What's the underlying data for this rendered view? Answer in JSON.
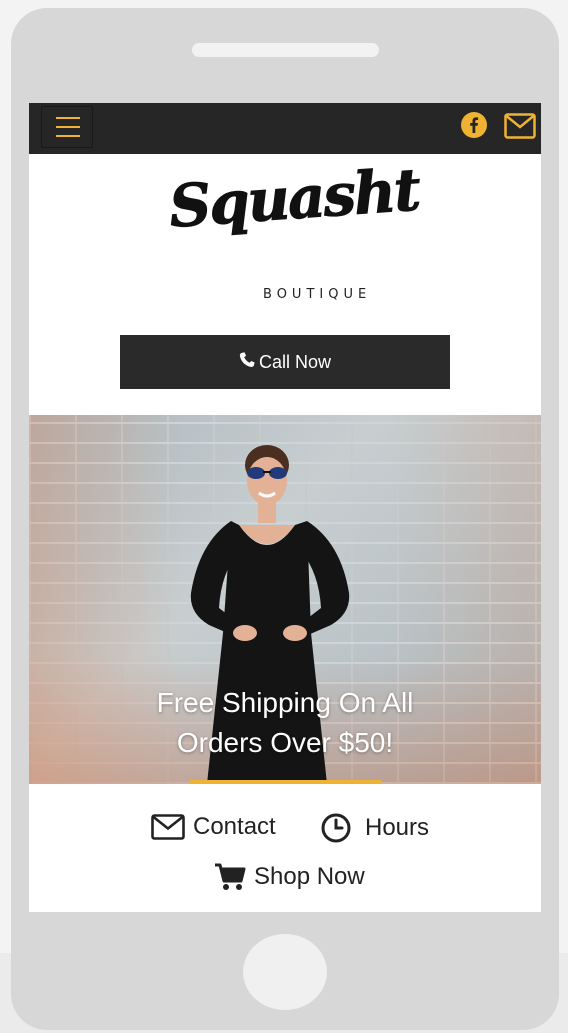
{
  "header": {
    "menu_icon": "hamburger-menu-icon",
    "social_icons": [
      "facebook-icon",
      "mail-icon"
    ]
  },
  "logo": {
    "script_text": "Squasht",
    "sub_text": "BOUTIQUE"
  },
  "call_button": {
    "label": "Call Now",
    "icon": "phone-icon"
  },
  "hero": {
    "caption_line1": "Free Shipping On All",
    "caption_line2": "Orders Over $50!"
  },
  "links": {
    "contact_label": "Contact",
    "hours_label": "Hours",
    "shop_label": "Shop Now"
  },
  "colors": {
    "accent": "#f0b233",
    "navbar": "#262626",
    "button": "#2a2a2a",
    "device_frame": "#d7d7d7"
  }
}
